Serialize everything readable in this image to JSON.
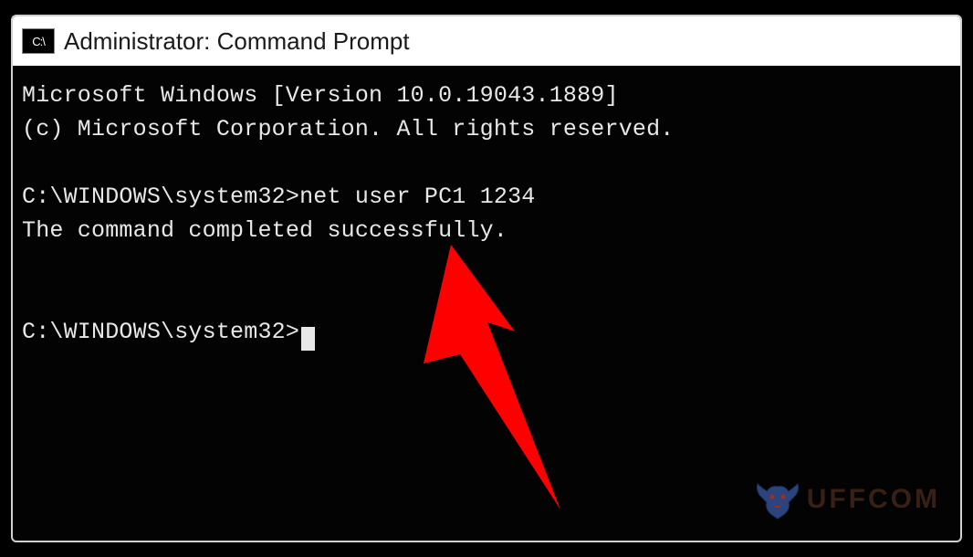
{
  "window": {
    "icon_label": "C:\\",
    "title": "Administrator: Command Prompt"
  },
  "terminal": {
    "header_line1": "Microsoft Windows [Version 10.0.19043.1889]",
    "header_line2": "(c) Microsoft Corporation. All rights reserved.",
    "prompt1_path": "C:\\WINDOWS\\system32>",
    "prompt1_command": "net user PC1 1234",
    "result_line": "The command completed successfully.",
    "prompt2_path": "C:\\WINDOWS\\system32>"
  },
  "annotation": {
    "arrow_color": "#ff0000"
  },
  "watermark": {
    "text": "UFFCOM",
    "icon_color": "#3a5aa8"
  }
}
